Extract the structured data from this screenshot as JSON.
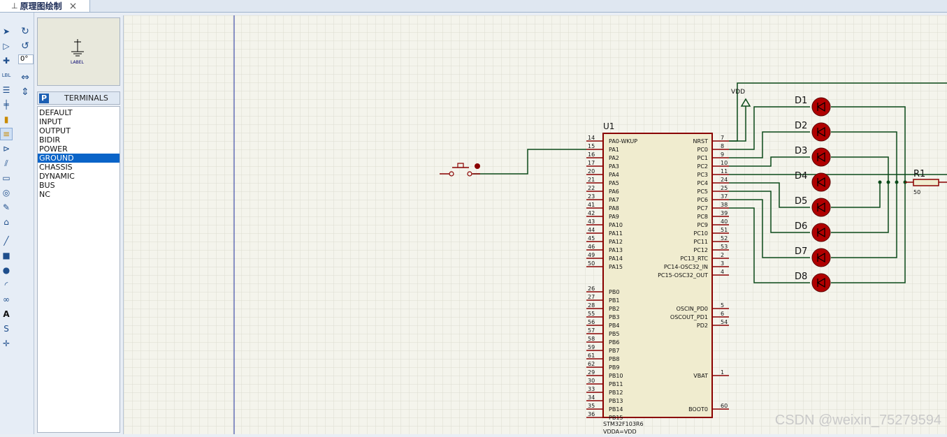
{
  "tab": {
    "title": "原理图绘制",
    "close_symbol": "×"
  },
  "toolbar": {
    "rotation": "0°"
  },
  "preview": {
    "label": "LABEL"
  },
  "terminals": {
    "badge": "P",
    "title": "TERMINALS",
    "items": [
      "DEFAULT",
      "INPUT",
      "OUTPUT",
      "BIDIR",
      "POWER",
      "GROUND",
      "CHASSIS",
      "DYNAMIC",
      "BUS",
      "NC"
    ],
    "selected": "GROUND"
  },
  "schematic": {
    "ref": "U1",
    "part": "STM32F103R6",
    "vdda": "VDDA=VDD",
    "power_label": "VDD",
    "left_pins": [
      {
        "num": "14",
        "name": "PA0-WKUP"
      },
      {
        "num": "15",
        "name": "PA1"
      },
      {
        "num": "16",
        "name": "PA2"
      },
      {
        "num": "17",
        "name": "PA3"
      },
      {
        "num": "20",
        "name": "PA4"
      },
      {
        "num": "21",
        "name": "PA5"
      },
      {
        "num": "22",
        "name": "PA6"
      },
      {
        "num": "23",
        "name": "PA7"
      },
      {
        "num": "41",
        "name": "PA8"
      },
      {
        "num": "42",
        "name": "PA9"
      },
      {
        "num": "43",
        "name": "PA10"
      },
      {
        "num": "44",
        "name": "PA11"
      },
      {
        "num": "45",
        "name": "PA12"
      },
      {
        "num": "46",
        "name": "PA13"
      },
      {
        "num": "49",
        "name": "PA14"
      },
      {
        "num": "50",
        "name": "PA15"
      },
      {
        "num": "26",
        "name": "PB0"
      },
      {
        "num": "27",
        "name": "PB1"
      },
      {
        "num": "28",
        "name": "PB2"
      },
      {
        "num": "55",
        "name": "PB3"
      },
      {
        "num": "56",
        "name": "PB4"
      },
      {
        "num": "57",
        "name": "PB5"
      },
      {
        "num": "58",
        "name": "PB6"
      },
      {
        "num": "59",
        "name": "PB7"
      },
      {
        "num": "61",
        "name": "PB8"
      },
      {
        "num": "62",
        "name": "PB9"
      },
      {
        "num": "29",
        "name": "PB10"
      },
      {
        "num": "30",
        "name": "PB11"
      },
      {
        "num": "33",
        "name": "PB12"
      },
      {
        "num": "34",
        "name": "PB13"
      },
      {
        "num": "35",
        "name": "PB14"
      },
      {
        "num": "36",
        "name": "PB15"
      }
    ],
    "right_pins": [
      {
        "num": "7",
        "name": "NRST"
      },
      {
        "num": "8",
        "name": "PC0"
      },
      {
        "num": "9",
        "name": "PC1"
      },
      {
        "num": "10",
        "name": "PC2"
      },
      {
        "num": "11",
        "name": "PC3"
      },
      {
        "num": "24",
        "name": "PC4"
      },
      {
        "num": "25",
        "name": "PC5"
      },
      {
        "num": "37",
        "name": "PC6"
      },
      {
        "num": "38",
        "name": "PC7"
      },
      {
        "num": "39",
        "name": "PC8"
      },
      {
        "num": "40",
        "name": "PC9"
      },
      {
        "num": "51",
        "name": "PC10"
      },
      {
        "num": "52",
        "name": "PC11"
      },
      {
        "num": "53",
        "name": "PC12"
      },
      {
        "num": "2",
        "name": "PC13_RTC"
      },
      {
        "num": "3",
        "name": "PC14-OSC32_IN"
      },
      {
        "num": "4",
        "name": "PC15-OSC32_OUT"
      },
      {
        "num": "5",
        "name": "OSCIN_PD0"
      },
      {
        "num": "6",
        "name": "OSCOUT_PD1"
      },
      {
        "num": "54",
        "name": "PD2"
      },
      {
        "num": "1",
        "name": "VBAT"
      },
      {
        "num": "60",
        "name": "BOOT0"
      }
    ],
    "leds": [
      "D1",
      "D2",
      "D3",
      "D4",
      "D5",
      "D6",
      "D7",
      "D8"
    ],
    "resistor": {
      "ref": "R1",
      "value": "50"
    }
  },
  "watermark": "CSDN @weixin_75279594",
  "colors": {
    "wire": "#0b4a1a",
    "component": "#8a0000",
    "led": "#b00000",
    "selection": "#0a64c8",
    "grid": "#d9d9cc"
  }
}
